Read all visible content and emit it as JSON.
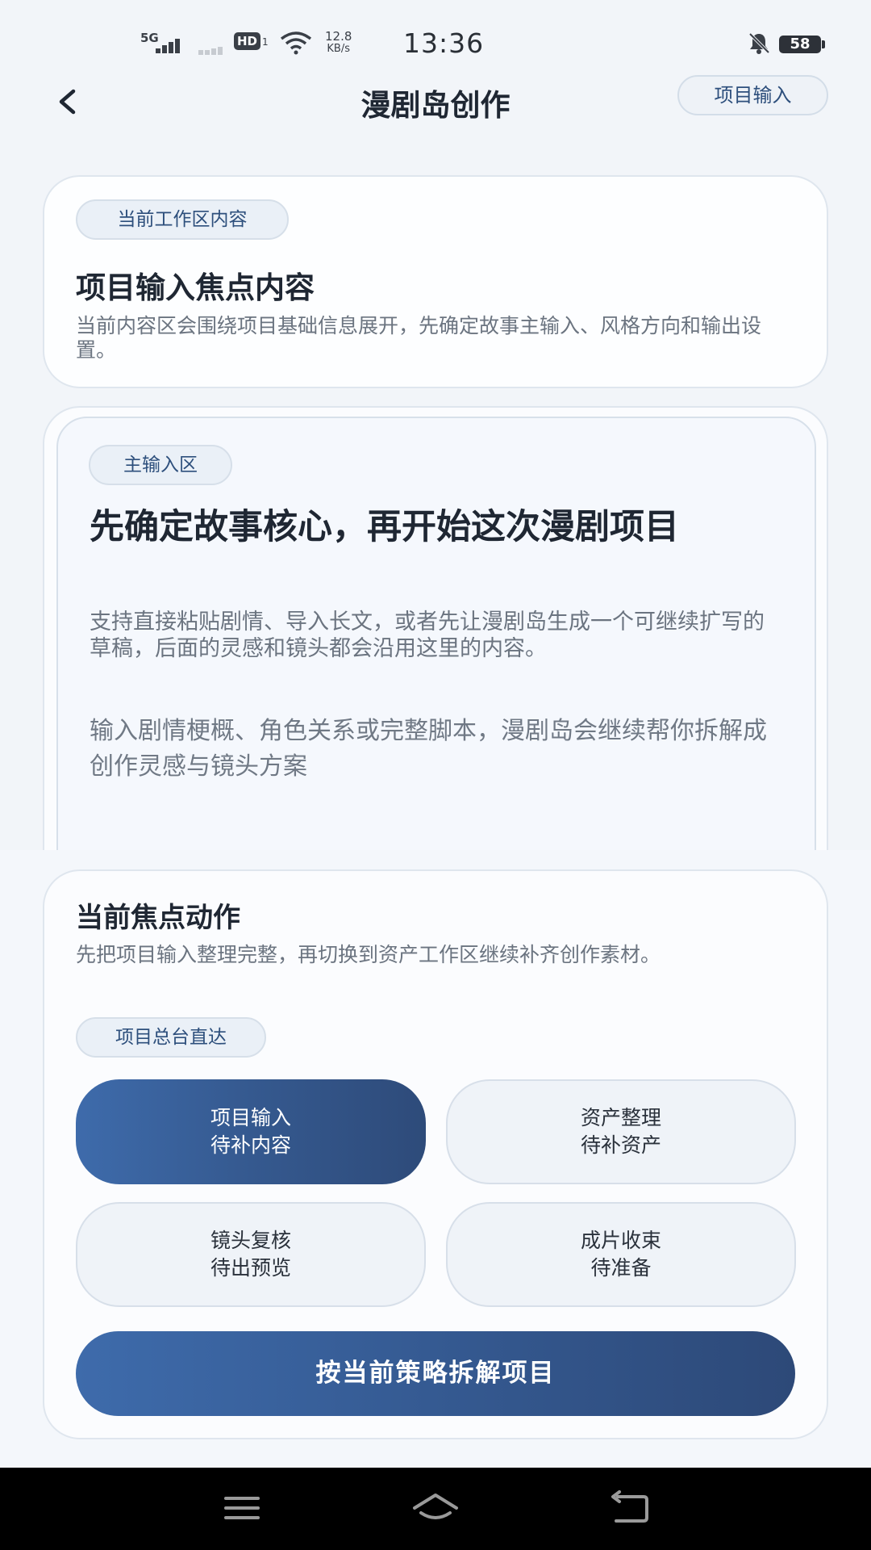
{
  "status_bar": {
    "signal_label": "5G",
    "hd_label": "HD",
    "hd_sub": "1",
    "net_speed_value": "12.8",
    "net_speed_unit": "KB/s",
    "time": "13:36",
    "battery": "58"
  },
  "header": {
    "title": "漫剧岛创作",
    "right_pill": "项目输入"
  },
  "workspace_card": {
    "tag": "当前工作区内容",
    "title": "项目输入焦点内容",
    "description": "当前内容区会围绕项目基础信息展开，先确定故事主输入、风格方向和输出设置。"
  },
  "main_input": {
    "tag": "主输入区",
    "title": "先确定故事核心，再开始这次漫剧项目",
    "description": "支持直接粘贴剧情、导入长文，或者先让漫剧岛生成一个可继续扩写的草稿，后面的灵感和镜头都会沿用这里的内容。",
    "placeholder": "输入剧情梗概、角色关系或完整脚本，漫剧岛会继续帮你拆解成创作灵感与镜头方案"
  },
  "focus_action": {
    "title": "当前焦点动作",
    "description": "先把项目输入整理完整，再切换到资产工作区继续补齐创作素材。",
    "tag": "项目总台直达",
    "buttons": [
      {
        "line1": "项目输入",
        "line2": "待补内容"
      },
      {
        "line1": "资产整理",
        "line2": "待补资产"
      },
      {
        "line1": "镜头复核",
        "line2": "待出预览"
      },
      {
        "line1": "成片收束",
        "line2": "待准备"
      }
    ],
    "primary_button": "按当前策略拆解项目"
  },
  "colors": {
    "accent": "#3e6bab",
    "accent_dark": "#2e4b7a",
    "background": "#f2f5f9",
    "tag_text": "#2d4f7c"
  },
  "icons": {
    "back": "chevron-left-icon",
    "mute": "bell-off-icon",
    "nav_menu": "menu-icon",
    "nav_home": "home-icon",
    "nav_back": "back-icon"
  }
}
